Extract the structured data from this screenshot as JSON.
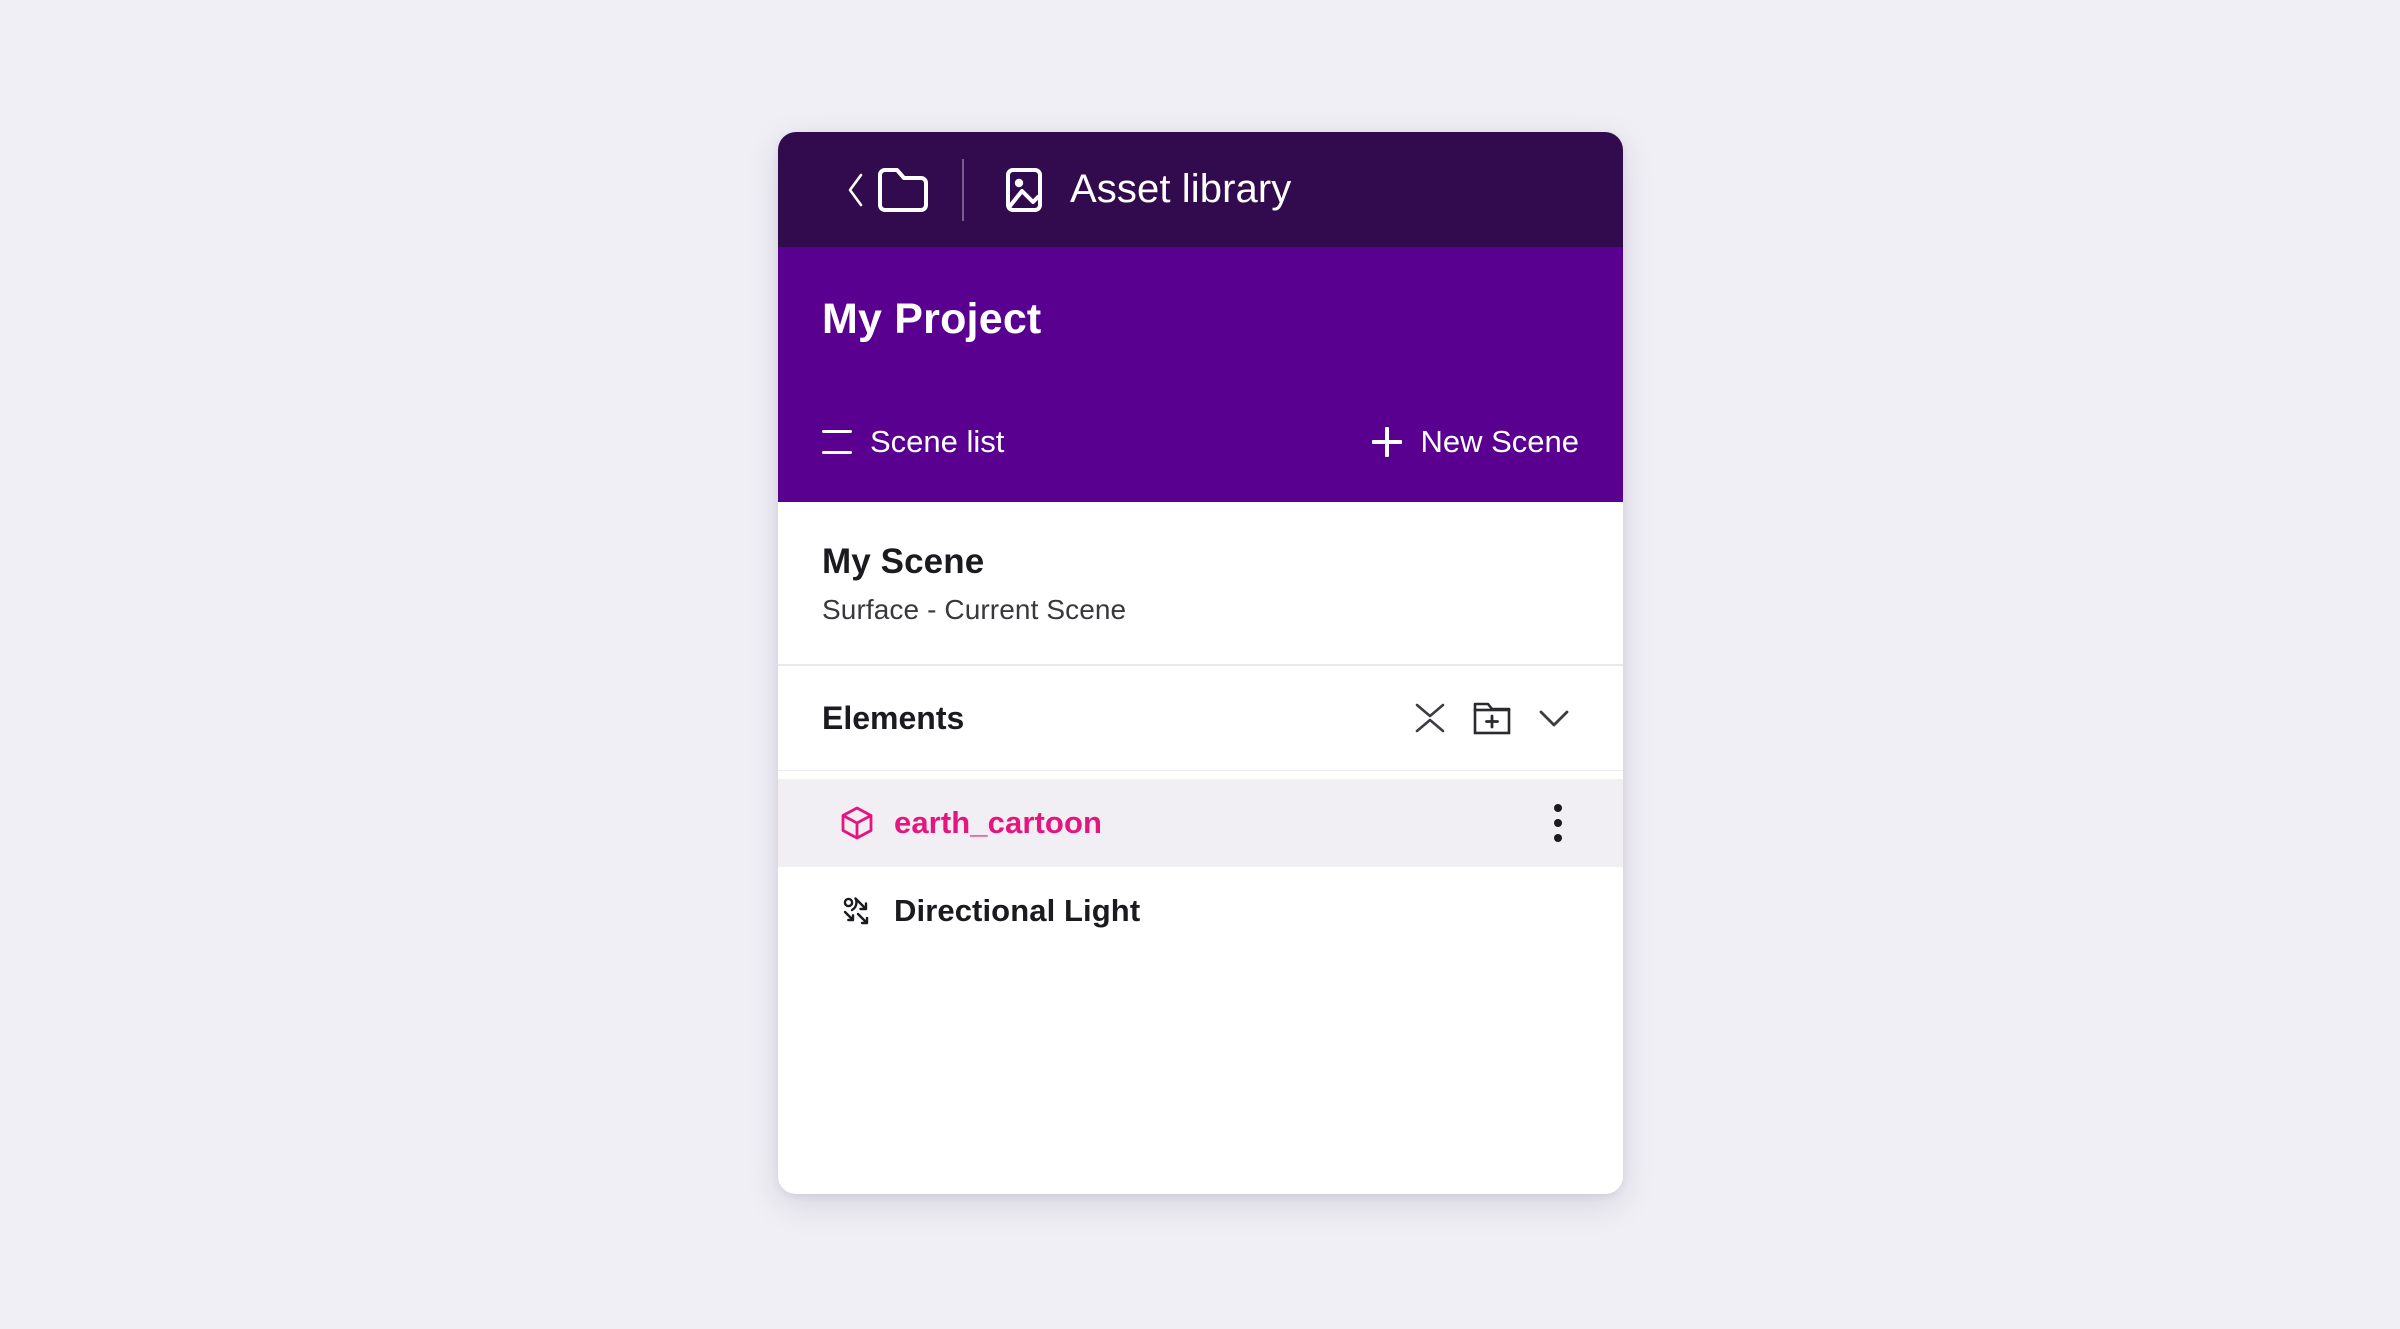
{
  "page": {
    "background_color": "#f0eff5"
  },
  "topbar": {
    "background_color": "#310b4d",
    "back_icon": "chevron-left-icon",
    "folder_icon": "folder-icon",
    "asset_icon": "image-icon",
    "title": "Asset library"
  },
  "projectbar": {
    "background_color": "#5a0091",
    "title": "My Project",
    "scene_list_label": "Scene list",
    "scene_list_icon": "list-icon",
    "new_scene_label": "New Scene",
    "new_scene_icon": "plus-icon"
  },
  "scene": {
    "name": "My Scene",
    "subtitle": "Surface - Current Scene"
  },
  "elements": {
    "title": "Elements",
    "collapse_icon": "collapse-all-icon",
    "new_folder_icon": "folder-plus-icon",
    "expand_icon": "chevron-down-icon",
    "selected_color": "#e5157f",
    "selected_row_background": "#f1eff4",
    "items": [
      {
        "label": "earth_cartoon",
        "icon": "cube-icon",
        "selected": true,
        "menu_icon": "kebab-menu-icon"
      },
      {
        "label": "Directional Light",
        "icon": "directional-light-icon",
        "selected": false,
        "menu_icon": null
      }
    ]
  }
}
